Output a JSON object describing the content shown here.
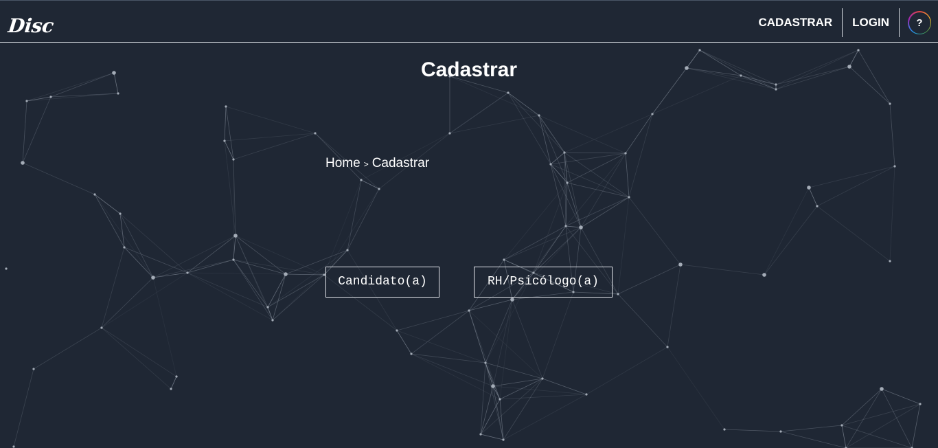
{
  "header": {
    "logo": "Disc",
    "nav": {
      "register_label": "CADASTRAR",
      "login_label": "LOGIN",
      "help_label": "?"
    }
  },
  "main": {
    "title": "Cadastrar",
    "breadcrumb": {
      "home": "Home",
      "separator": ">",
      "current": "Cadastrar"
    },
    "options": {
      "candidate_label": "Candidato(a)",
      "hr_label": "RH/Psicólogo(a)"
    }
  },
  "colors": {
    "background": "#1f2734",
    "text": "#ffffff",
    "network_lines": "#8a93a0"
  }
}
